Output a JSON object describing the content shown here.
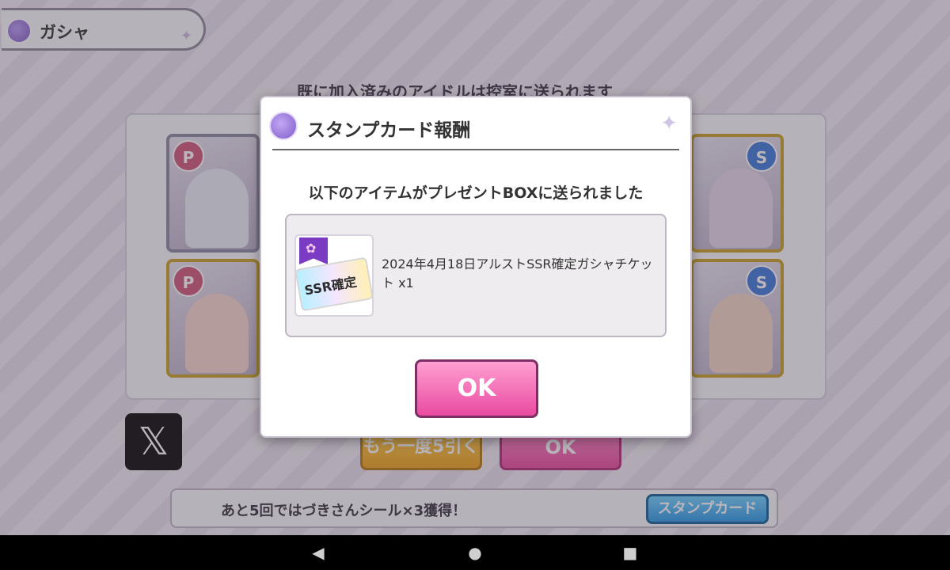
{
  "header": {
    "title": "ガシャ"
  },
  "background": {
    "notice": "既に加入済みのアイドルは控室に送られます",
    "again_button": "もう一度5引く",
    "ok_button": "OK",
    "x_icon_glyph": "𝕏"
  },
  "stamp_bar": {
    "text": "あと5回ではづきさんシール×3獲得！",
    "button": "スタンプカード"
  },
  "modal": {
    "title": "スタンプカード報酬",
    "message": "以下のアイテムがプレゼントBOXに送られました",
    "item": {
      "name": "2024年4月18日アルストSSR確定ガシャチケット x1",
      "ticket_text": "SSR確定"
    },
    "ok_button": "OK"
  },
  "navbar": {
    "back": "◀",
    "home": "●",
    "recents": "■"
  },
  "colors": {
    "accent_pink": "#ea4aa0",
    "accent_gold": "#f0a21a",
    "accent_blue": "#2a9be6",
    "accent_purple": "#7f5cc8"
  }
}
